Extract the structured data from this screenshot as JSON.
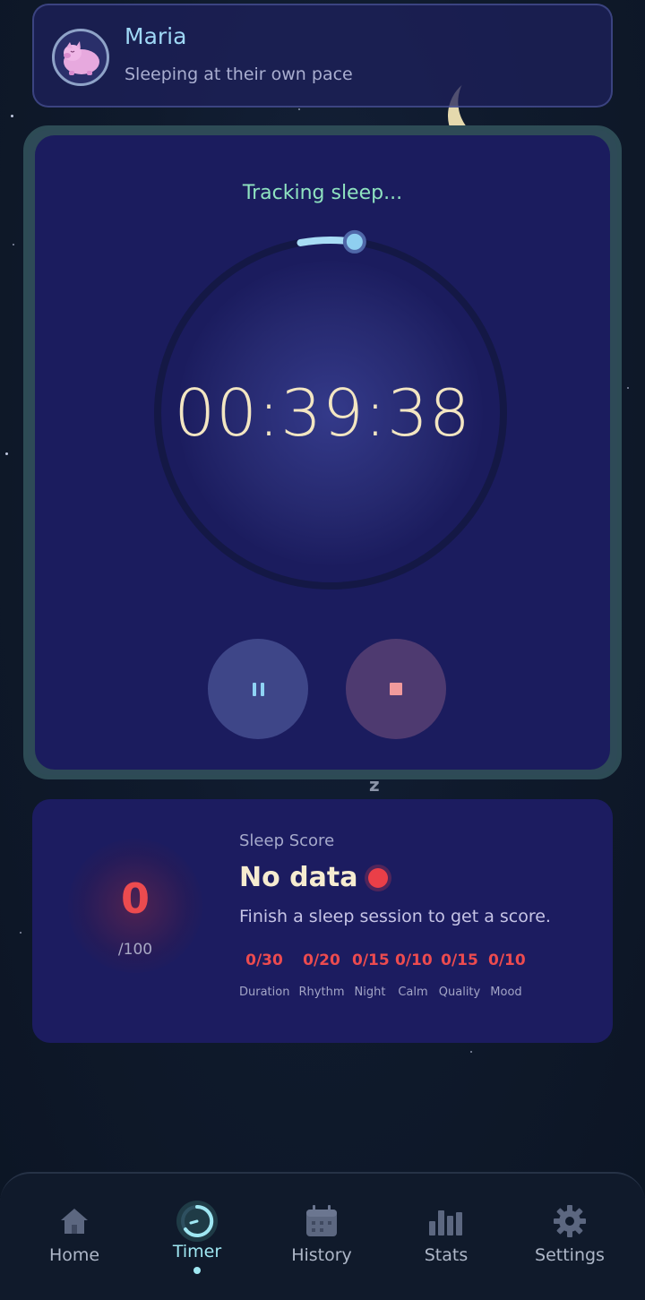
{
  "profile": {
    "name": "Maria",
    "subtitle": "Sleeping at their own pace",
    "avatar_icon": "sleeping-pig-icon"
  },
  "timer": {
    "status": "Tracking sleep...",
    "time": "00:39:38",
    "progress": 0.05,
    "pause_icon": "pause-icon",
    "stop_icon": "stop-icon"
  },
  "sleep_score": {
    "label": "Sleep Score",
    "value": "0",
    "max": "/100",
    "headline": "No data",
    "description": "Finish a sleep session to get a score.",
    "metrics": [
      {
        "value": "0/30",
        "label": "Duration"
      },
      {
        "value": "0/20",
        "label": "Rhythm"
      },
      {
        "value": "0/15",
        "label": "Night"
      },
      {
        "value": "0/10",
        "label": "Calm"
      },
      {
        "value": "0/15",
        "label": "Quality"
      },
      {
        "value": "0/10",
        "label": "Mood"
      }
    ]
  },
  "nav": {
    "items": [
      {
        "label": "Home",
        "icon": "home-icon",
        "active": false
      },
      {
        "label": "Timer",
        "icon": "timer-icon",
        "active": true
      },
      {
        "label": "History",
        "icon": "calendar-icon",
        "active": false
      },
      {
        "label": "Stats",
        "icon": "bar-chart-icon",
        "active": false
      },
      {
        "label": "Settings",
        "icon": "gear-icon",
        "active": false
      }
    ]
  },
  "colors": {
    "accent_cyan": "#9fe7f2",
    "score_red": "#ec4b4f",
    "timer_text": "#f3e6c2",
    "status_green": "#8fe3c0",
    "card_bg": "#1b1c5e"
  }
}
